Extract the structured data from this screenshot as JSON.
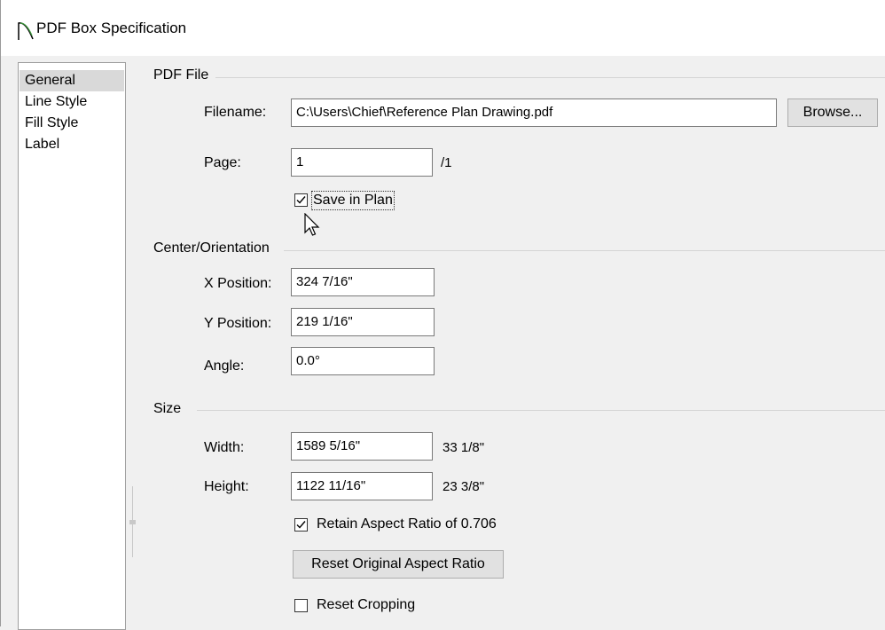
{
  "window": {
    "title": "PDF Box Specification"
  },
  "nav": {
    "items": [
      {
        "label": "General",
        "selected": true
      },
      {
        "label": "Line Style",
        "selected": false
      },
      {
        "label": "Fill Style",
        "selected": false
      },
      {
        "label": "Label",
        "selected": false
      }
    ]
  },
  "pdf_file": {
    "group_label": "PDF File",
    "filename_label": "Filename:",
    "filename_value": "C:\\Users\\Chief\\Reference Plan Drawing.pdf",
    "browse_label": "Browse...",
    "page_label": "Page:",
    "page_value": "1",
    "page_total": "/1",
    "save_in_plan_label": "Save in Plan",
    "save_in_plan_checked": true
  },
  "center": {
    "group_label": "Center/Orientation",
    "x_label": "X Position:",
    "x_value": "324 7/16\"",
    "y_label": "Y Position:",
    "y_value": "219 1/16\"",
    "angle_label": "Angle:",
    "angle_value": "0.0°"
  },
  "size": {
    "group_label": "Size",
    "width_label": "Width:",
    "width_value": "1589 5/16\"",
    "width_extra": "33 1/8\"",
    "height_label": "Height:",
    "height_value": "1122 11/16\"",
    "height_extra": "23 3/8\"",
    "retain_label": "Retain Aspect Ratio of 0.706",
    "retain_checked": true,
    "reset_aspect_label": "Reset Original Aspect Ratio",
    "reset_cropping_label": "Reset Cropping",
    "reset_cropping_checked": false
  },
  "colors": {
    "accent_icon": "#2e7d32",
    "selection": "#d9d9d9"
  }
}
